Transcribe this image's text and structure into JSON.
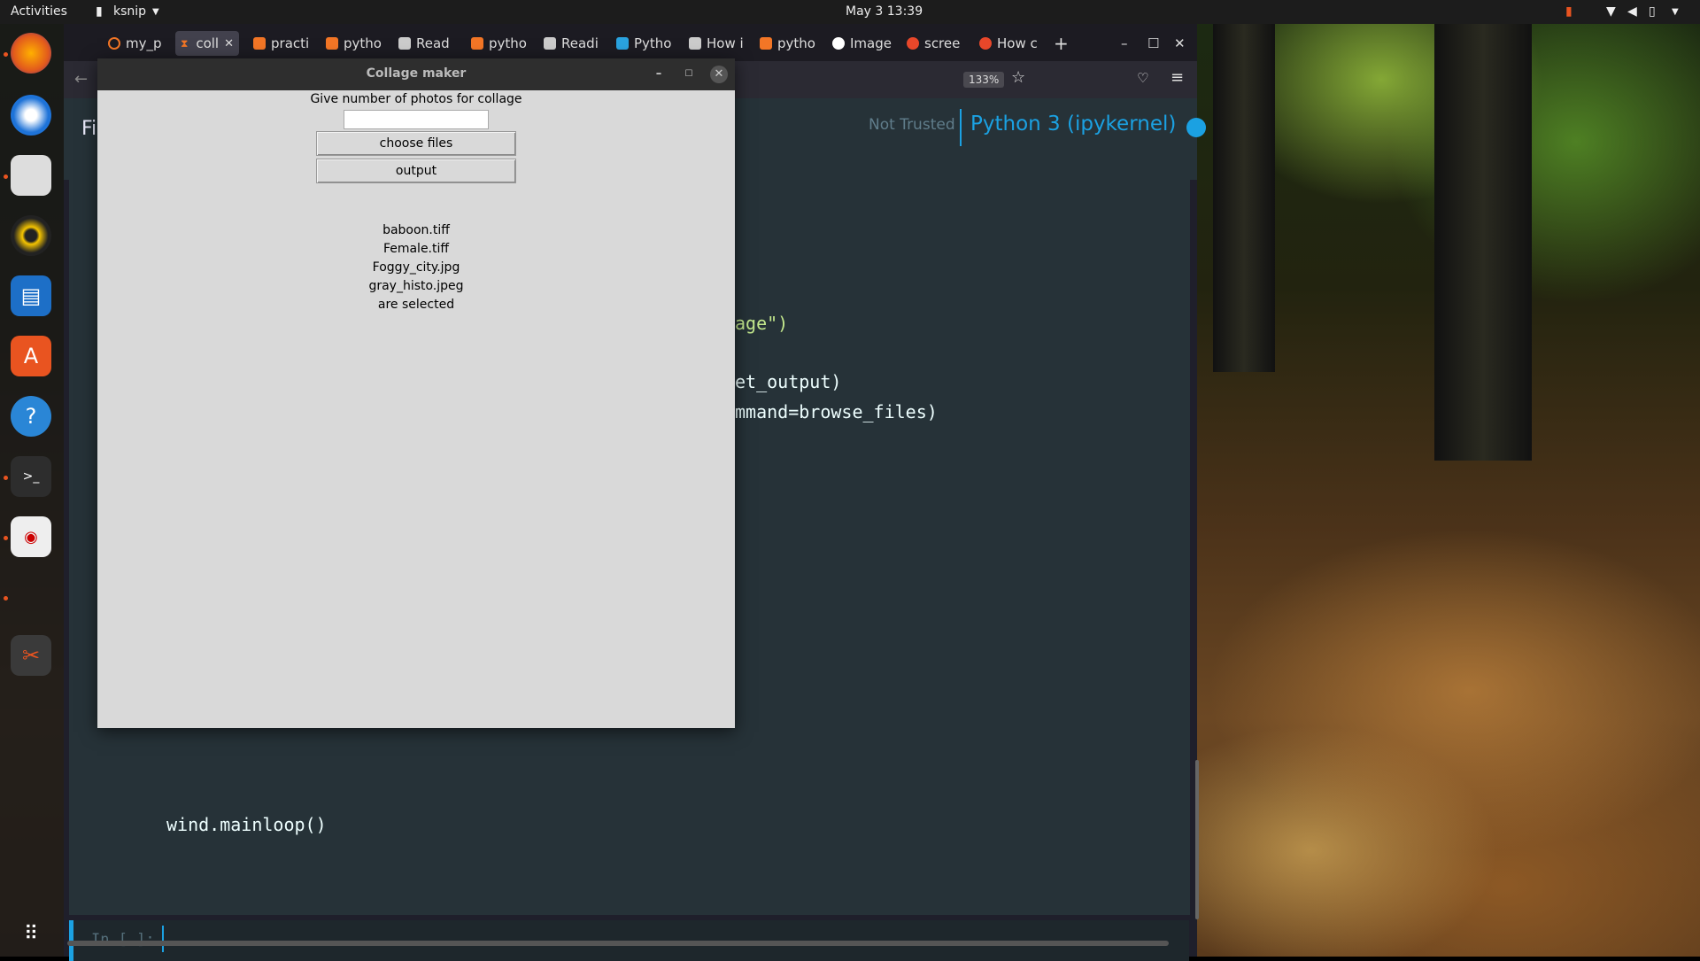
{
  "topbar": {
    "activities": "Activities",
    "app_name": "ksnip",
    "clock": "May 3  13:39"
  },
  "browser": {
    "tabs": [
      {
        "label": "my_p",
        "icon": "jupyter-icon"
      },
      {
        "label": "coll",
        "icon": "jupyter-icon"
      },
      {
        "label": "practi",
        "icon": "jupyter-icon"
      },
      {
        "label": "pytho",
        "icon": "jupyter-icon"
      },
      {
        "label": "Read",
        "icon": "site-icon"
      },
      {
        "label": "pytho",
        "icon": "jupyter-icon"
      },
      {
        "label": "Readi",
        "icon": "site-icon"
      },
      {
        "label": "Pytho",
        "icon": "site-icon"
      },
      {
        "label": "How i",
        "icon": "site-icon"
      },
      {
        "label": "pytho",
        "icon": "jupyter-icon"
      },
      {
        "label": "Image",
        "icon": "github-icon"
      },
      {
        "label": "scree",
        "icon": "askubuntu-icon"
      },
      {
        "label": "How c",
        "icon": "askubuntu-icon"
      }
    ],
    "zoom": "133%",
    "jupyter_menu_first": "Fi",
    "trust_status": "Not Trusted",
    "kernel": "Python 3 (ipykernel)"
  },
  "notebook": {
    "code_lines": [
      "age\")",
      "et_output)",
      "mmand=browse_files)",
      "wind.mainloop()"
    ],
    "prompt": "In [ ]:"
  },
  "dialog": {
    "title": "Collage maker",
    "prompt_label": "Give number of photos for collage",
    "entry_value": "",
    "choose_files_label": "choose files",
    "output_label": "output",
    "selected_files": [
      "baboon.tiff",
      "Female.tiff",
      "Foggy_city.jpg",
      "gray_histo.jpeg"
    ],
    "selected_suffix": "are selected"
  },
  "colors": {
    "jupyter_bg": "#263238",
    "kernel_text": "#1ba1e2",
    "dialog_bg": "#d9d9d9"
  }
}
